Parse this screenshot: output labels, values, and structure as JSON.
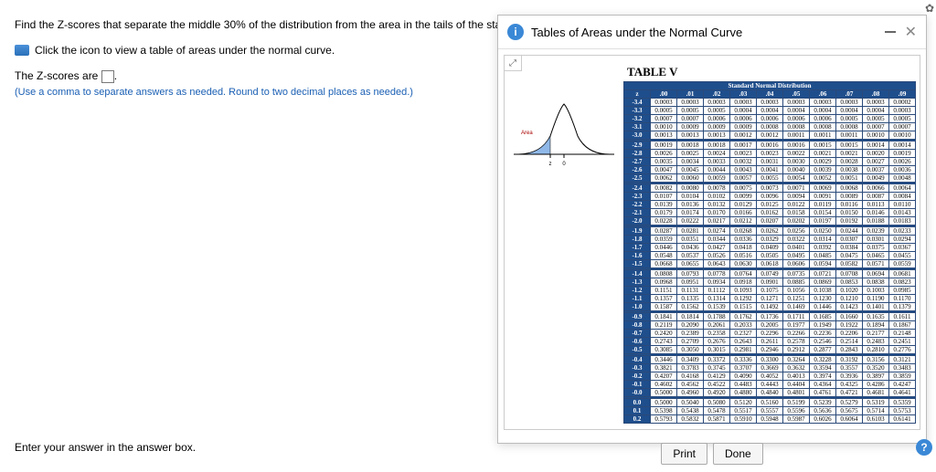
{
  "main": {
    "prompt": "Find the Z-scores that separate the middle 30% of the distribution from the area in the tails of the standard normal distribution.",
    "hint": "Click the icon to view a table of areas under the normal curve.",
    "ans_label": "The Z-scores are",
    "instr": "(Use a comma to separate answers as needed. Round to two decimal places as needed.)",
    "enter": "Enter your answer in the answer box."
  },
  "popup": {
    "title": "Tables of Areas under the Normal Curve",
    "table_label": "TABLE V",
    "dist_label": "Standard Normal Distribution",
    "curve_label": "Area",
    "print": "Print",
    "done": "Done"
  },
  "chart_data": {
    "type": "table",
    "title": "Standard Normal Distribution",
    "col_headers": [
      "z",
      ".00",
      ".01",
      ".02",
      ".03",
      ".04",
      ".05",
      ".06",
      ".07",
      ".08",
      ".09"
    ],
    "rows": [
      [
        "-3.4",
        "0.0003",
        "0.0003",
        "0.0003",
        "0.0003",
        "0.0003",
        "0.0003",
        "0.0003",
        "0.0003",
        "0.0003",
        "0.0002"
      ],
      [
        "-3.3",
        "0.0005",
        "0.0005",
        "0.0005",
        "0.0004",
        "0.0004",
        "0.0004",
        "0.0004",
        "0.0004",
        "0.0004",
        "0.0003"
      ],
      [
        "-3.2",
        "0.0007",
        "0.0007",
        "0.0006",
        "0.0006",
        "0.0006",
        "0.0006",
        "0.0006",
        "0.0005",
        "0.0005",
        "0.0005"
      ],
      [
        "-3.1",
        "0.0010",
        "0.0009",
        "0.0009",
        "0.0009",
        "0.0008",
        "0.0008",
        "0.0008",
        "0.0008",
        "0.0007",
        "0.0007"
      ],
      [
        "-3.0",
        "0.0013",
        "0.0013",
        "0.0013",
        "0.0012",
        "0.0012",
        "0.0011",
        "0.0011",
        "0.0011",
        "0.0010",
        "0.0010"
      ],
      [
        "-2.9",
        "0.0019",
        "0.0018",
        "0.0018",
        "0.0017",
        "0.0016",
        "0.0016",
        "0.0015",
        "0.0015",
        "0.0014",
        "0.0014"
      ],
      [
        "-2.8",
        "0.0026",
        "0.0025",
        "0.0024",
        "0.0023",
        "0.0023",
        "0.0022",
        "0.0021",
        "0.0021",
        "0.0020",
        "0.0019"
      ],
      [
        "-2.7",
        "0.0035",
        "0.0034",
        "0.0033",
        "0.0032",
        "0.0031",
        "0.0030",
        "0.0029",
        "0.0028",
        "0.0027",
        "0.0026"
      ],
      [
        "-2.6",
        "0.0047",
        "0.0045",
        "0.0044",
        "0.0043",
        "0.0041",
        "0.0040",
        "0.0039",
        "0.0038",
        "0.0037",
        "0.0036"
      ],
      [
        "-2.5",
        "0.0062",
        "0.0060",
        "0.0059",
        "0.0057",
        "0.0055",
        "0.0054",
        "0.0052",
        "0.0051",
        "0.0049",
        "0.0048"
      ],
      [
        "-2.4",
        "0.0082",
        "0.0080",
        "0.0078",
        "0.0075",
        "0.0073",
        "0.0071",
        "0.0069",
        "0.0068",
        "0.0066",
        "0.0064"
      ],
      [
        "-2.3",
        "0.0107",
        "0.0104",
        "0.0102",
        "0.0099",
        "0.0096",
        "0.0094",
        "0.0091",
        "0.0089",
        "0.0087",
        "0.0084"
      ],
      [
        "-2.2",
        "0.0139",
        "0.0136",
        "0.0132",
        "0.0129",
        "0.0125",
        "0.0122",
        "0.0119",
        "0.0116",
        "0.0113",
        "0.0110"
      ],
      [
        "-2.1",
        "0.0179",
        "0.0174",
        "0.0170",
        "0.0166",
        "0.0162",
        "0.0158",
        "0.0154",
        "0.0150",
        "0.0146",
        "0.0143"
      ],
      [
        "-2.0",
        "0.0228",
        "0.0222",
        "0.0217",
        "0.0212",
        "0.0207",
        "0.0202",
        "0.0197",
        "0.0192",
        "0.0188",
        "0.0183"
      ],
      [
        "-1.9",
        "0.0287",
        "0.0281",
        "0.0274",
        "0.0268",
        "0.0262",
        "0.0256",
        "0.0250",
        "0.0244",
        "0.0239",
        "0.0233"
      ],
      [
        "-1.8",
        "0.0359",
        "0.0351",
        "0.0344",
        "0.0336",
        "0.0329",
        "0.0322",
        "0.0314",
        "0.0307",
        "0.0301",
        "0.0294"
      ],
      [
        "-1.7",
        "0.0446",
        "0.0436",
        "0.0427",
        "0.0418",
        "0.0409",
        "0.0401",
        "0.0392",
        "0.0384",
        "0.0375",
        "0.0367"
      ],
      [
        "-1.6",
        "0.0548",
        "0.0537",
        "0.0526",
        "0.0516",
        "0.0505",
        "0.0495",
        "0.0485",
        "0.0475",
        "0.0465",
        "0.0455"
      ],
      [
        "-1.5",
        "0.0668",
        "0.0655",
        "0.0643",
        "0.0630",
        "0.0618",
        "0.0606",
        "0.0594",
        "0.0582",
        "0.0571",
        "0.0559"
      ],
      [
        "-1.4",
        "0.0808",
        "0.0793",
        "0.0778",
        "0.0764",
        "0.0749",
        "0.0735",
        "0.0721",
        "0.0708",
        "0.0694",
        "0.0681"
      ],
      [
        "-1.3",
        "0.0968",
        "0.0951",
        "0.0934",
        "0.0918",
        "0.0901",
        "0.0885",
        "0.0869",
        "0.0853",
        "0.0838",
        "0.0823"
      ],
      [
        "-1.2",
        "0.1151",
        "0.1131",
        "0.1112",
        "0.1093",
        "0.1075",
        "0.1056",
        "0.1038",
        "0.1020",
        "0.1003",
        "0.0985"
      ],
      [
        "-1.1",
        "0.1357",
        "0.1335",
        "0.1314",
        "0.1292",
        "0.1271",
        "0.1251",
        "0.1230",
        "0.1210",
        "0.1190",
        "0.1170"
      ],
      [
        "-1.0",
        "0.1587",
        "0.1562",
        "0.1539",
        "0.1515",
        "0.1492",
        "0.1469",
        "0.1446",
        "0.1423",
        "0.1401",
        "0.1379"
      ],
      [
        "-0.9",
        "0.1841",
        "0.1814",
        "0.1788",
        "0.1762",
        "0.1736",
        "0.1711",
        "0.1685",
        "0.1660",
        "0.1635",
        "0.1611"
      ],
      [
        "-0.8",
        "0.2119",
        "0.2090",
        "0.2061",
        "0.2033",
        "0.2005",
        "0.1977",
        "0.1949",
        "0.1922",
        "0.1894",
        "0.1867"
      ],
      [
        "-0.7",
        "0.2420",
        "0.2389",
        "0.2358",
        "0.2327",
        "0.2296",
        "0.2266",
        "0.2236",
        "0.2206",
        "0.2177",
        "0.2148"
      ],
      [
        "-0.6",
        "0.2743",
        "0.2709",
        "0.2676",
        "0.2643",
        "0.2611",
        "0.2578",
        "0.2546",
        "0.2514",
        "0.2483",
        "0.2451"
      ],
      [
        "-0.5",
        "0.3085",
        "0.3050",
        "0.3015",
        "0.2981",
        "0.2946",
        "0.2912",
        "0.2877",
        "0.2843",
        "0.2810",
        "0.2776"
      ],
      [
        "-0.4",
        "0.3446",
        "0.3409",
        "0.3372",
        "0.3336",
        "0.3300",
        "0.3264",
        "0.3228",
        "0.3192",
        "0.3156",
        "0.3121"
      ],
      [
        "-0.3",
        "0.3821",
        "0.3783",
        "0.3745",
        "0.3707",
        "0.3669",
        "0.3632",
        "0.3594",
        "0.3557",
        "0.3520",
        "0.3483"
      ],
      [
        "-0.2",
        "0.4207",
        "0.4168",
        "0.4129",
        "0.4090",
        "0.4052",
        "0.4013",
        "0.3974",
        "0.3936",
        "0.3897",
        "0.3859"
      ],
      [
        "-0.1",
        "0.4602",
        "0.4562",
        "0.4522",
        "0.4483",
        "0.4443",
        "0.4404",
        "0.4364",
        "0.4325",
        "0.4286",
        "0.4247"
      ],
      [
        "-0.0",
        "0.5000",
        "0.4960",
        "0.4920",
        "0.4880",
        "0.4840",
        "0.4801",
        "0.4761",
        "0.4721",
        "0.4681",
        "0.4641"
      ],
      [
        "0.0",
        "0.5000",
        "0.5040",
        "0.5080",
        "0.5120",
        "0.5160",
        "0.5199",
        "0.5239",
        "0.5279",
        "0.5319",
        "0.5359"
      ],
      [
        "0.1",
        "0.5398",
        "0.5438",
        "0.5478",
        "0.5517",
        "0.5557",
        "0.5596",
        "0.5636",
        "0.5675",
        "0.5714",
        "0.5753"
      ],
      [
        "0.2",
        "0.5793",
        "0.5832",
        "0.5871",
        "0.5910",
        "0.5948",
        "0.5987",
        "0.6026",
        "0.6064",
        "0.6103",
        "0.6141"
      ]
    ],
    "group_breaks": [
      5,
      10,
      15,
      20,
      25,
      30,
      35
    ]
  }
}
